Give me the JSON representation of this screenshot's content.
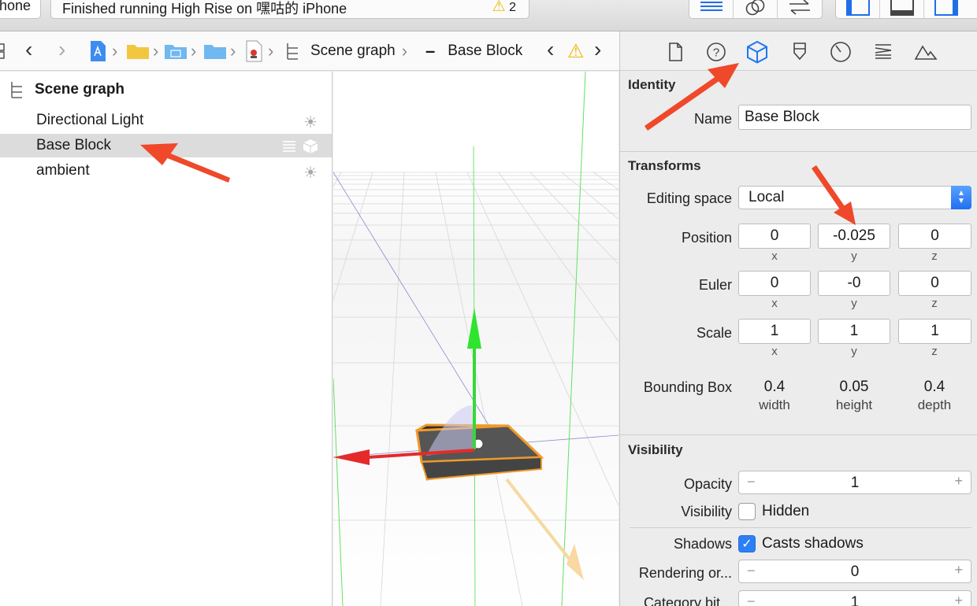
{
  "toolbar": {
    "scheme_label": "hone",
    "status_text": "Finished running High Rise on 嘿咕的 iPhone",
    "warning_count": "2"
  },
  "jumpbar": {
    "crumbs": [
      "Scene graph",
      "Base Block"
    ]
  },
  "outline": {
    "header": "Scene graph",
    "items": [
      {
        "label": "Directional Light",
        "icon": "sun-icon"
      },
      {
        "label": "Base Block",
        "icon": "geometry-icon"
      },
      {
        "label": "ambient",
        "icon": "sun-icon"
      }
    ]
  },
  "inspector": {
    "identity": {
      "title": "Identity",
      "name_label": "Name",
      "name_value": "Base Block"
    },
    "transforms": {
      "title": "Transforms",
      "editing_space_label": "Editing space",
      "editing_space_value": "Local",
      "position_label": "Position",
      "position": {
        "x": "0",
        "y": "-0.025",
        "z": "0"
      },
      "euler_label": "Euler",
      "euler": {
        "x": "0",
        "y": "-0",
        "z": "0"
      },
      "scale_label": "Scale",
      "scale": {
        "x": "1",
        "y": "1",
        "z": "1"
      },
      "axis": {
        "x": "x",
        "y": "y",
        "z": "z"
      },
      "bbox_label": "Bounding Box",
      "bbox": {
        "width": "0.4",
        "height": "0.05",
        "depth": "0.4",
        "width_label": "width",
        "height_label": "height",
        "depth_label": "depth"
      }
    },
    "visibility": {
      "title": "Visibility",
      "opacity_label": "Opacity",
      "opacity_value": "1",
      "visibility_label": "Visibility",
      "hidden_label": "Hidden",
      "shadows_label": "Shadows",
      "casts_shadows_label": "Casts shadows",
      "rendering_label": "Rendering or...",
      "rendering_value": "0",
      "category_label": "Category bit...",
      "category_value": "1"
    }
  },
  "colors": {
    "accent": "#2d7ff5",
    "annotation_arrow": "#f0482a",
    "warning": "#f0b400"
  }
}
